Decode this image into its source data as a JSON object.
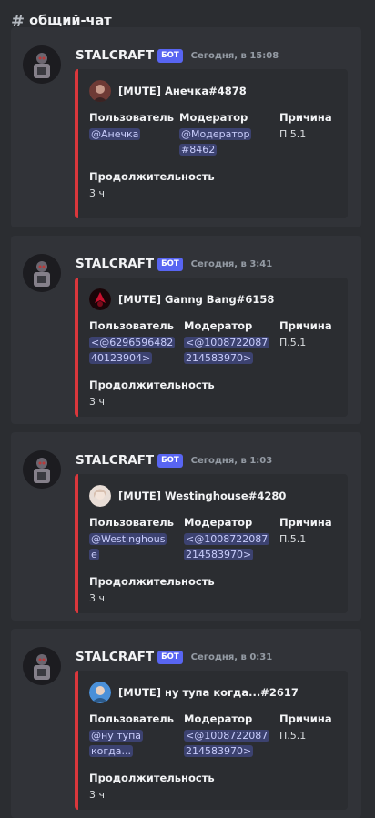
{
  "channel": {
    "hash": "#",
    "name": "общий-чат"
  },
  "labels": {
    "user": "Пользователь",
    "moderator": "Модератор",
    "reason": "Причина",
    "duration": "Продолжительность"
  },
  "messages": [
    {
      "author": "STALCRAFT",
      "bot_tag": "БОТ",
      "time": "Сегодня, в 15:08",
      "embed_color": "#da373c",
      "title": "[MUTE] Анечка#4878",
      "user_line1": "@Анечка",
      "user_line2": "",
      "moderator_line1": "@Модератор",
      "moderator_line2": "#8462",
      "reason": "П 5.1",
      "duration": "3 ч"
    },
    {
      "author": "STALCRAFT",
      "bot_tag": "БОТ",
      "time": "Сегодня, в 3:41",
      "embed_color": "#da373c",
      "title": "[MUTE] Ganng Bang#6158",
      "user_line1": "<@6296596482",
      "user_line2": "40123904>",
      "moderator_line1": "<@1008722087",
      "moderator_line2": "214583970>",
      "reason": "П.5.1",
      "duration": "3 ч"
    },
    {
      "author": "STALCRAFT",
      "bot_tag": "БОТ",
      "time": "Сегодня, в 1:03",
      "embed_color": "#da373c",
      "title": "[MUTE] Westinghouse#4280",
      "user_line1": "@Westinghous",
      "user_line2": "e",
      "moderator_line1": "<@1008722087",
      "moderator_line2": "214583970>",
      "reason": "П.5.1",
      "duration": "3 ч"
    },
    {
      "author": "STALCRAFT",
      "bot_tag": "БОТ",
      "time": "Сегодня, в 0:31",
      "embed_color": "#da373c",
      "title": "[MUTE] ну тупа когда...#2617",
      "user_line1": "@ну тупа",
      "user_line2": "когда...",
      "moderator_line1": "<@1008722087",
      "moderator_line2": "214583970>",
      "reason": "П.5.1",
      "duration": "3 ч"
    }
  ]
}
